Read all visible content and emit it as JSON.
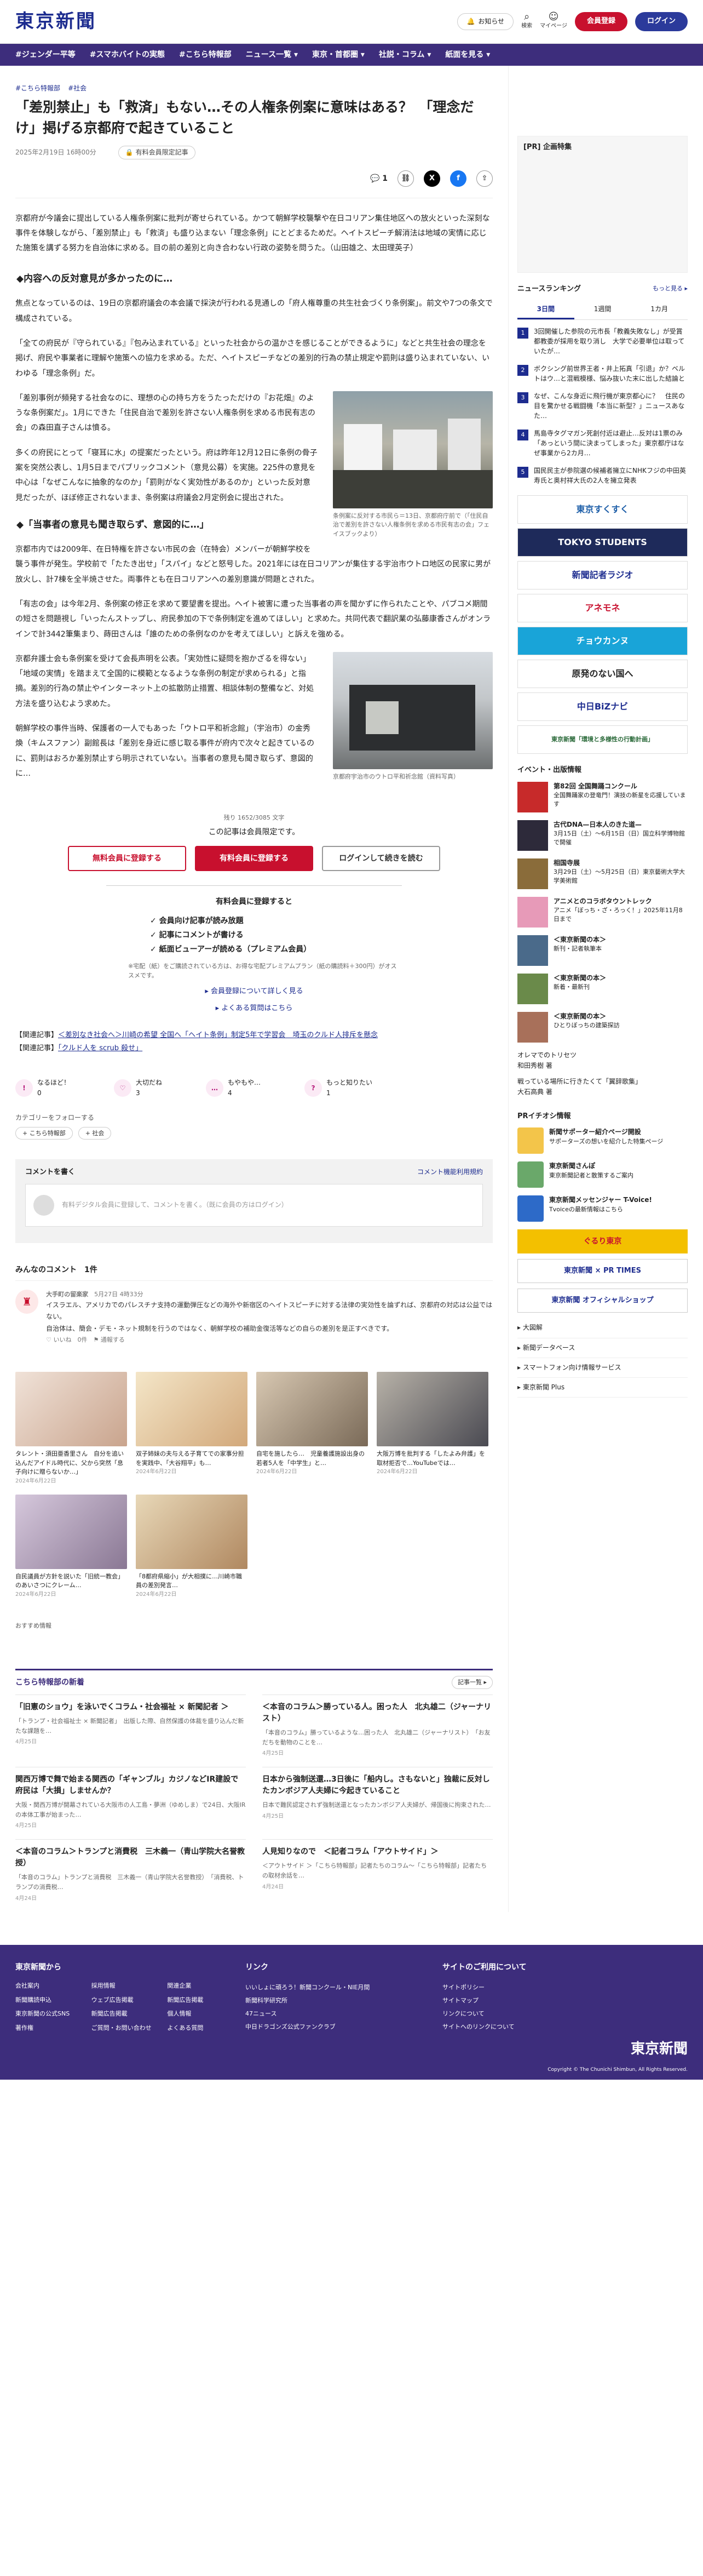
{
  "header": {
    "logo": "東京新聞",
    "notice": "お知らせ",
    "search": "検索",
    "mypage": "マイページ",
    "register": "会員登録",
    "login": "ログイン"
  },
  "nav": [
    "#ジェンダー平等",
    "#スマホバイトの実態",
    "#こちら特報部",
    "ニュース一覧 ▾",
    "東京・首都圏 ▾",
    "社説・コラム ▾",
    "紙面を見る ▾"
  ],
  "article": {
    "tags": [
      "#こちら特報部",
      "#社会"
    ],
    "title": "「差別禁止」も「救済」もない…その人権条例案に意味はある？　「理念だけ」掲げる京都府で起きていること",
    "date": "2025年2月19日 16時00分",
    "badge": "有料会員限定記事",
    "comments": "1",
    "lead": "京都府が今議会に提出している人権条例案に批判が寄せられている。かつて朝鮮学校襲撃や在日コリアン集住地区への放火といった深刻な事件を体験しながら、「差別禁止」も「救済」も盛り込まない「理念条例」にとどまるためだ。ヘイトスピーチ解消法は地域の実情に応じた施策を講ずる努力を自治体に求める。目の前の差別と向き合わない行政の姿勢を問うた。（山田雄之、太田理英子）",
    "h1": "◆内容への反対意見が多かったのに…",
    "p1": "焦点となっているのは、19日の京都府議会の本会議で採決が行われる見通しの「府人権尊重の共生社会づくり条例案」。前文や7つの条文で構成されている。",
    "p2": "「全ての府民が『守られている』『包み込まれている』といった社会からの温かさを感じることができるように」などと共生社会の理念を掲げ、府民や事業者に理解や施策への協力を求める。ただ、ヘイトスピーチなどの差別的行為の禁止規定や罰則は盛り込まれていない、いわゆる「理念条例」だ。",
    "p3": "「差別事例が頻発する社会なのに、理想の心の持ち方をうたっただけの『お花畑』のような条例案だ」。1月にできた「住民自治で差別を許さない人権条例を求める市民有志の会」の森田直子さんは憤る。",
    "p4": "多くの府民にとって「寝耳に水」の提案だったという。府は昨年12月12日に条例の骨子案を突然公表し、1月5日までパブリックコメント（意見公募）を実施。225件の意見を中心は「なぜこんなに抽象的なのか」「罰則がなく実効性があるのか」といった反対意見だったが、ほぼ修正されないまま、条例案は府議会2月定例会に提出された。",
    "h2": "◆「当事者の意見も聞き取らず、意図的に…」",
    "p5": "京都市内では2009年、在日特権を許さない市民の会（在特会）メンバーが朝鮮学校を襲う事件が発生。学校前で「たたき出せ」「スパイ」などと怒号した。2021年には在日コリアンが集住する宇治市ウトロ地区の民家に男が放火し、計7棟を全半焼させた。両事件とも在日コリアンへの差別意識が問題とされた。",
    "p6": "「有志の会」は今年2月、条例案の修正を求めて要望書を提出。ヘイト被害に遭った当事者の声を聞かずに作られたことや、パブコメ期間の短さを問題視し「いったんストップし、府民参加の下で条例制定を進めてほしい」と求めた。共同代表で翻訳業の弘藤康香さんがオンラインで計3442筆集まり、蒔田さんは「誰のための条例なのかを考えてほしい」と訴えを強める。",
    "p7": "京都弁護士会も条例案を受けて会長声明を公表。「実効性に疑問を抱かざるを得ない」「地域の実情」を踏まえて全国的に模範となるような条例の制定が求められる」と指摘。差別的行為の禁止やインターネット上の拡散防止措置、相談体制の整備など、対処方法を盛り込むよう求めた。",
    "p8": "朝鮮学校の事件当時、保護者の一人でもあった「ウトロ平和祈念館」（宇治市）の金秀煥（キムスファン）副館長は「差別を身近に感じ取る事件が府内で次々と起きているのに、罰則はおろか差別禁止すら明示されていない。当事者の意見も聞き取らず、意図的に…",
    "cap1": "条例案に反対する市民ら＝13日、京都府庁前で（「住民自治で差別を許さない人権条例を求める市民有志の会」フェイスブックより）",
    "cap2": "京都府宇治市のウトロ平和祈念館（資料写真）"
  },
  "paywall": {
    "count": "残り 1652/3085 文字",
    "msg": "この記事は会員限定です。",
    "b1": "無料会員に登録する",
    "b2": "有料会員に登録する",
    "b3": "ログインして続きを読む",
    "bhead": "有料会員に登録すると",
    "items": [
      "✓ 会員向け記事が読み放題",
      "✓ 記事にコメントが書ける",
      "✓ 紙面ビューアーが読める（プレミアム会員）"
    ],
    "note": "※宅配（紙）をご購読されている方は、お得な宅配プレミアムプラン（紙の購読料＋300円）がオススメです。",
    "l1": "▸ 会員登録について詳しく見る",
    "l2": "▸ よくある質問はこちら"
  },
  "related": {
    "label1": "【関連記事】",
    "link1": "＜差別なき社会へ＞川崎の希望 全国へ「ヘイト条例」制定5年で学習会　埼玉のクルド人排斥を懸念",
    "label2": "【関連記事】",
    "link2": "「クルド人を scrub 殺せ」"
  },
  "reactions": [
    {
      "icon": "!",
      "label": "なるほど！",
      "n": "0"
    },
    {
      "icon": "♡",
      "label": "大切だね",
      "n": "3"
    },
    {
      "icon": "…",
      "label": "もやもや…",
      "n": "4"
    },
    {
      "icon": "?",
      "label": "もっと知りたい",
      "n": "1"
    }
  ],
  "follow": {
    "label": "カテゴリーをフォローする",
    "c1": "+ こちら特報部",
    "c2": "+ 社会"
  },
  "commentbox": {
    "title": "コメントを書く",
    "guide": "コメント機能利用規約",
    "input": "有料デジタル会員に登録して、コメントを書く。（既に会員の方はログイン）"
  },
  "comments": {
    "title": "みんなのコメント　1件",
    "user": "大手町の留楽家",
    "date": "5月27日 4時33分",
    "text": "イスラエル、アメリカでのパレスチナ支持の運動弾圧などの海外や新宿区のヘイトスピーチに対する法律の実効性を論ずれば、京都府の対応は公益ではない。",
    "text2": "自治体は、簡会・デモ・ネット規制を行うのではなく、朝鮮学校の補助金復活等などの自らの差別を是正すべきです。",
    "like": "♡ いいね　0件",
    "report": "⚑ 通報する"
  },
  "cards": [
    {
      "t": "タレント・須田亜香里さん　自分を追い込んだアイドル時代に、父から突然「息子向けに贈らないか…」",
      "d": "2024年6月22日"
    },
    {
      "t": "双子姉妹の夫与える子育てでの家事分担を実践中、「大谷翔平」も…",
      "d": "2024年6月22日"
    },
    {
      "t": "自宅を施したら…　児童養護施設出身の若者5人を「中学生」と…",
      "d": "2024年6月22日"
    },
    {
      "t": "大阪万博を批判する「したよみ弁護」を取材拒否で…YouTubeでは…",
      "d": "2024年6月22日"
    },
    {
      "t": "自民議員が方針を説いた「旧統一教会」のあいさつにクレーム…",
      "d": "2024年6月22日"
    },
    {
      "t": "「8都府県縮小」が大相撲に…川崎市職員の差別発言…",
      "d": "2024年6月22日"
    }
  ],
  "recommend": "おすすめ情報",
  "tokkaibu": {
    "title": "こちら特報部の新着",
    "more": "記事一覧 ▸",
    "items": [
      {
        "t": "「旧憲のショウ」を泳いでくコラム・社会福祉 × 新聞記者 ＞",
        "d": "「トランプ・社会福祉士 × 新聞記者」　出版した際、自然保護の体裁を盛り込んだ新たな課題を…",
        "dt": "4月25日"
      },
      {
        "t": "＜本音のコラム＞勝っている人。困った人　北丸雄二（ジャーナリスト）",
        "d": "「本音のコラム」勝っているような…困った人　北丸雄二（ジャーナリスト）　「お友だちを動物のことを…",
        "dt": "4月25日"
      },
      {
        "t": "関西万博で舞で始まる関西の「ギャンブル」カジノなどIR建設で府民は「大損」しませんか？",
        "d": "大阪・関西万博が開幕されている大阪市の人工島・夢洲（ゆめしま）で24日、大阪IRの本体工事が始まった…",
        "dt": "4月25日"
      },
      {
        "t": "日本から強制送還…3日後に「船内し。さもないと」独裁に反対したカンボジア人夫婦に今起きていること",
        "d": "日本で難民認定されず強制送還となったカンボジア人夫婦が、帰国後に拘束された…",
        "dt": "4月25日"
      },
      {
        "t": "＜本音のコラム＞トランプと消費税　三木義一（青山学院大名誉教授）",
        "d": "「本音のコラム」トランプと消費税　三木義一（青山学院大名誉教授）　「消費税、トランプの消費税…",
        "dt": "4月24日"
      },
      {
        "t": "人見知りなので　＜記者コラム「アウトサイド」＞",
        "d": "＜アウトサイド ＞「こちら特報部」記者たちのコラム〜「こちら特報部」記者たちの取材余話を…",
        "dt": "4月24日"
      }
    ]
  },
  "side": {
    "ad": "[PR] 企画特集",
    "rank": "ニュースランキング",
    "rankmore": "もっと見る ▸",
    "tabs": [
      "3日間",
      "1週間",
      "1カ月"
    ],
    "ranks": [
      "3回開催した参院の元市長「教義失敗なし」が受賞　都教委が採用を取り消し　大学で必要単位は取っていたが…",
      "ボクシング前世界王者・井上拓真「引退」か？ベルトはウ…と混戦模様、悩み抜いた末に出した結論と",
      "なぜ、こんな身近に飛行機が東京都心に？　住民の目を驚かせる戦闘機「本当に新型？」ニュースあなた…",
      "馬島寺タグマガン死創付近は避止…反対は1票のみ「あっという間に決まってしまった」東京都庁はなぜ事業から2カ月…",
      "国民民主が参院選の候補者擁立にNHKフジの中田英寿氏と奥村祥大氏の2人を擁立発表"
    ],
    "banners": [
      "東京すくすく",
      "TOKYO STUDENTS",
      "新聞記者ラジオ",
      "アネモネ",
      "チョウカンヌ",
      "原発のない国へ",
      "中日BiZナビ",
      "東京新聞「環境と多様性の行動計画」"
    ],
    "evhead": "イベント・出版情報",
    "events": [
      {
        "b": "第82回 全国舞踊コンクール",
        "t": "全国舞踊家の登竜門！演技の新星を応援しています"
      },
      {
        "b": "古代DNA—日本人のきた道—",
        "t": "3月15日（土）〜6月15日（日）国立科学博物館で開催"
      },
      {
        "b": "相国寺展",
        "t": "3月29日（土）〜5月25日（日）東京藝術大学大学美術館"
      },
      {
        "b": "アニメとのコラボタウントレック",
        "t": "アニメ「ぼっち・ざ・ろっく！」2025年11月8日まで"
      },
      {
        "b": "＜東京新聞の本＞",
        "t": "新刊・記者執筆本"
      },
      {
        "b": "＜東京新聞の本＞",
        "t": "新着・最新刊"
      },
      {
        "b": "＜東京新聞の本＞",
        "t": "ひとりぼっちの建築探訪"
      }
    ],
    "sl1": "オレマでのトリセツ",
    "sl2": "和田秀樹 著",
    "sl3": "戦っている場所に行きたくて「翼辞歌集」",
    "sl4": "大石高典 著",
    "prhead": "PRイチオシ情報",
    "pr": [
      {
        "b": "新聞サポーター紹介ページ開設",
        "t": "サポーターズの想いを紹介した特集ページ"
      },
      {
        "b": "東京新聞さんぽ",
        "t": "東京新聞記者と散策するご案内"
      },
      {
        "b": "東京新聞メッセンジャー T-Voice!",
        "t": "Tvoiceの最新情報はこちら"
      }
    ],
    "b2": [
      "ぐるり東京",
      "東京新聞 × PR TIMES",
      "東京新聞 オフィシャルショップ"
    ],
    "links": [
      "▸ 大図解",
      "▸ 新聞データベース",
      "▸ スマートフォン向け情報サービス",
      "▸ 東京新聞 Plus"
    ]
  },
  "footer": {
    "h1": "東京新聞から",
    "h2": "リンク",
    "h3": "サイトのご利用について",
    "c1": [
      "会社案内",
      "新聞購読申込",
      "東京新聞の公式SNS",
      "著作権",
      "採用情報",
      "ウェブ広告掲載",
      "新聞広告掲載",
      "ご質問・お問い合わせ",
      "関連企業",
      "新聞広告掲載",
      "個人情報",
      "よくある質問"
    ],
    "c2": [
      "いいしょに頑ろう！新聞コンクール・NIE月間",
      "新聞科学研究所",
      "47ニュース",
      "中日ドラゴンズ公式ファンクラブ"
    ],
    "c3": [
      "サイトポリシー",
      "サイトマップ",
      "リンクについて",
      "サイトへのリンクについて"
    ],
    "logo": "東京新聞",
    "copy": "Copyright © The Chunichi Shimbun, All Rights Reserved."
  }
}
